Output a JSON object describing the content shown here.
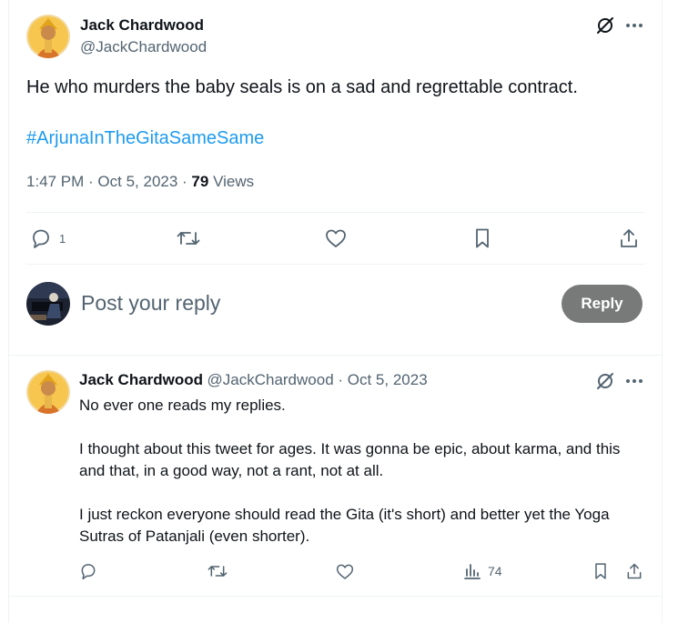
{
  "tweet": {
    "author_name": "Jack Chardwood",
    "author_handle": "@JackChardwood",
    "text": "He who murders the baby seals is on a sad and regrettable contract.",
    "hashtag": "#ArjunaInTheGitaSameSame",
    "time": "1:47 PM · Oct 5, 2023 · ",
    "views_count": "79",
    "views_label": " Views",
    "reply_count": "1"
  },
  "composer": {
    "placeholder": "Post your reply",
    "button_label": "Reply"
  },
  "reply": {
    "author_name": "Jack Chardwood",
    "author_handle": "@JackChardwood",
    "date": " · Oct 5, 2023",
    "paragraphs": [
      "No ever one reads my replies.",
      "I thought about this tweet for ages. It was gonna be epic, about karma, and this and that, in a good way, not a rant, not at all.",
      "I just reckon everyone should read the Gita (it's short) and better yet the Yoga Sutras of Patanjali (even shorter)."
    ],
    "views_count": "74"
  },
  "icons": {
    "grok": "grok-icon",
    "more": "more-icon",
    "reply": "reply-icon",
    "repost": "repost-icon",
    "like": "like-icon",
    "bookmark": "bookmark-icon",
    "share": "share-icon",
    "analytics": "analytics-icon"
  },
  "colors": {
    "accent": "#1d9bf0",
    "secondary_text": "#536471",
    "divider": "#eff3f4",
    "reply_button": "#787a7a"
  }
}
